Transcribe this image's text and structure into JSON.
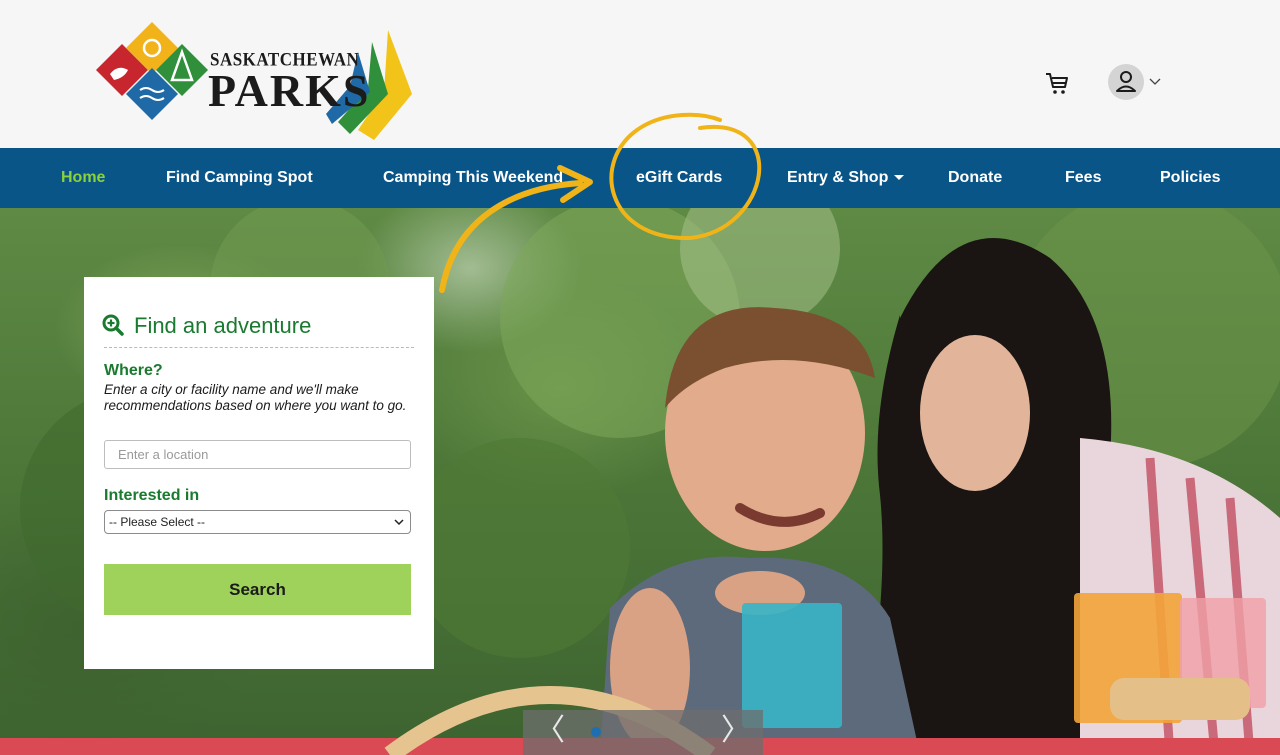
{
  "header": {
    "logo_line1": "SASKATCHEWAN",
    "logo_line2": "PARKS",
    "cart_icon": "cart-icon",
    "user_icon": "user-icon"
  },
  "nav": {
    "items": [
      {
        "label": "Home",
        "active": true
      },
      {
        "label": "Find Camping Spot"
      },
      {
        "label": "Camping This Weekend"
      },
      {
        "label": "eGift Cards"
      },
      {
        "label": "Entry & Shop"
      },
      {
        "label": "Donate"
      },
      {
        "label": "Fees"
      },
      {
        "label": "Policies"
      }
    ]
  },
  "search_panel": {
    "title": "Find an adventure",
    "where_label": "Where?",
    "where_help": "Enter a city or facility name and we'll make recommendations based on where you want to go.",
    "location_placeholder": "Enter a location",
    "interest_label": "Interested in",
    "interest_selected": "-- Please Select --",
    "search_button": "Search"
  },
  "carousel": {
    "prev_icon": "chevron-left-icon",
    "next_icon": "chevron-right-icon",
    "prev_glyph": "〈",
    "next_glyph": "〉",
    "active_slide": 1
  },
  "colors": {
    "nav_bg": "#0a5588",
    "nav_active": "#8bd13a",
    "accent_green": "#1a7a2f",
    "button_green": "#9fd25b",
    "annotation_gold": "#f0b418"
  }
}
